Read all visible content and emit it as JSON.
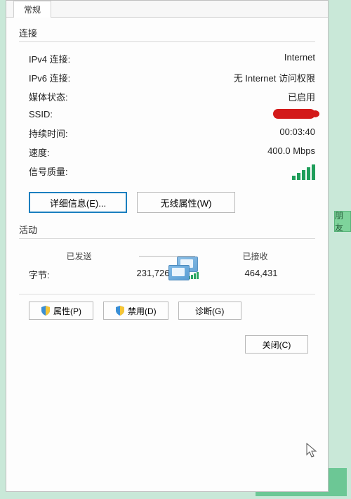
{
  "tab": {
    "general": "常规"
  },
  "connection": {
    "sectionLabel": "连接",
    "rows": {
      "ipv4": {
        "label": "IPv4 连接:",
        "value": "Internet"
      },
      "ipv6": {
        "label": "IPv6 连接:",
        "value": "无 Internet 访问权限"
      },
      "media": {
        "label": "媒体状态:",
        "value": "已启用"
      },
      "ssid": {
        "label": "SSID:",
        "value": ""
      },
      "duration": {
        "label": "持续时间:",
        "value": "00:03:40"
      },
      "speed": {
        "label": "速度:",
        "value": "400.0 Mbps"
      },
      "signal": {
        "label": "信号质量:"
      }
    },
    "buttons": {
      "details": "详细信息(E)...",
      "wireless": "无线属性(W)"
    }
  },
  "activity": {
    "sectionLabel": "活动",
    "sentLabel": "已发送",
    "recvLabel": "已接收",
    "bytesLabel": "字节:",
    "sent": "231,726",
    "recv": "464,431"
  },
  "bottomButtons": {
    "properties": "属性(P)",
    "disable": "禁用(D)",
    "diagnose": "诊断(G)"
  },
  "closeLabel": "关闭(C)",
  "sideText": "朋友"
}
